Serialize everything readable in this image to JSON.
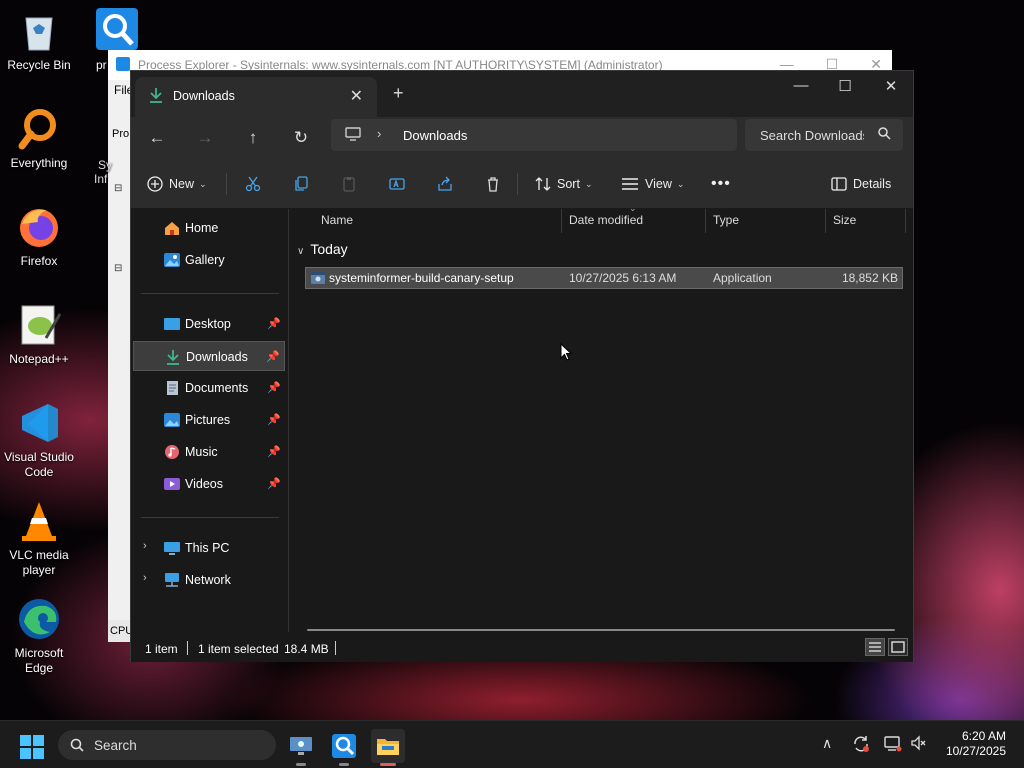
{
  "desktop": {
    "icons": [
      {
        "label": "Recycle Bin"
      },
      {
        "label": "pr"
      },
      {
        "label": "Everything"
      },
      {
        "label": "Firefox"
      },
      {
        "label": "Notepad++"
      },
      {
        "label": "Visual Studio Code"
      },
      {
        "label": "VLC media player"
      },
      {
        "label": "Microsoft Edge"
      }
    ]
  },
  "process_explorer": {
    "title": "Process Explorer - Sysinternals: www.sysinternals.com [NT AUTHORITY\\SYSTEM] (Administrator)",
    "menu_first": "File",
    "toolbar_fragment": "Pro",
    "cpu_label": "CPU",
    "side_fragments": [
      "Sy",
      "Inf"
    ]
  },
  "explorer": {
    "tab_label": "Downloads",
    "address": {
      "crumb": "Downloads"
    },
    "search_placeholder": "Search Downloads",
    "commands": {
      "new": "New",
      "sort": "Sort",
      "view": "View",
      "details": "Details"
    },
    "sidebar": {
      "home": "Home",
      "gallery": "Gallery",
      "quick_access": [
        {
          "label": "Desktop",
          "pinned": true
        },
        {
          "label": "Downloads",
          "pinned": true,
          "selected": true
        },
        {
          "label": "Documents",
          "pinned": true
        },
        {
          "label": "Pictures",
          "pinned": true
        },
        {
          "label": "Music",
          "pinned": true
        },
        {
          "label": "Videos",
          "pinned": true
        }
      ],
      "this_pc": "This PC",
      "network": "Network"
    },
    "columns": {
      "name": "Name",
      "date_modified": "Date modified",
      "type": "Type",
      "size": "Size"
    },
    "group": "Today",
    "files": [
      {
        "name": "systeminformer-build-canary-setup",
        "date_modified": "10/27/2025 6:13 AM",
        "type": "Application",
        "size": "18,852 KB",
        "selected": true
      }
    ],
    "status": {
      "count": "1 item",
      "selection": "1 item selected",
      "size": "18.4 MB"
    }
  },
  "taskbar": {
    "search_label": "Search",
    "clock": {
      "time": "6:20 AM",
      "date": "10/27/2025"
    }
  },
  "colors": {
    "accent": "#0078d4",
    "folder_download": "#3fb68b",
    "selection": "#4a4a4a"
  }
}
